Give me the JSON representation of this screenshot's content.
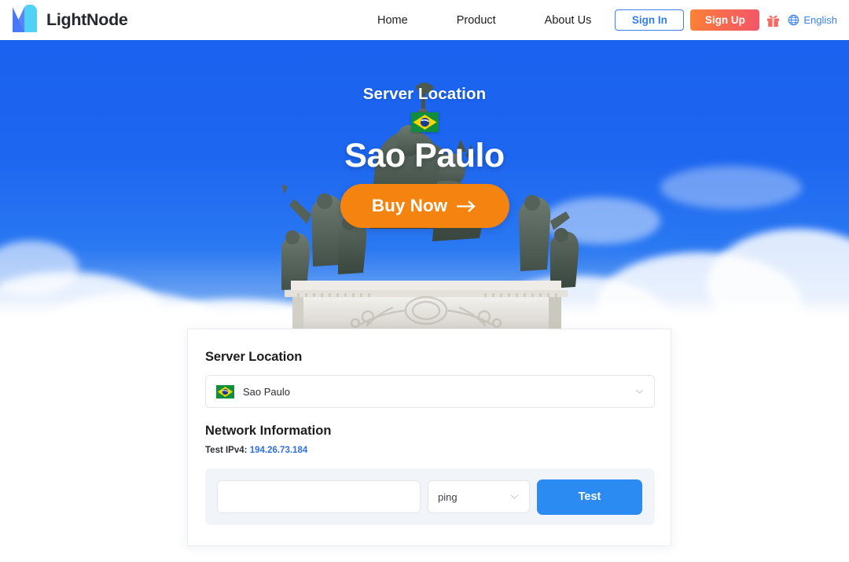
{
  "header": {
    "brand_name": "LightNode",
    "brand_logo_icon": "lightnode-logo-icon",
    "nav": [
      {
        "label": "Home"
      },
      {
        "label": "Product"
      },
      {
        "label": "About Us"
      }
    ],
    "sign_in_label": "Sign In",
    "sign_up_label": "Sign Up",
    "gift_icon": "gift-icon",
    "globe_icon": "globe-icon",
    "language_label": "English"
  },
  "hero": {
    "title": "Server Location",
    "flag_icon": "brazil-flag-icon",
    "city": "Sao Paulo",
    "buy_label": "Buy Now",
    "arrow_icon": "arrow-right-icon"
  },
  "card": {
    "server_location_heading": "Server Location",
    "location_select": {
      "flag_icon": "brazil-flag-icon",
      "value": "Sao Paulo",
      "chevron_icon": "chevron-down-icon"
    },
    "network_heading": "Network Information",
    "ip_label": "Test IPv4:",
    "ip_value": "194.26.73.184",
    "tool": {
      "input_value": "",
      "input_placeholder": "",
      "method_value": "ping",
      "method_chevron_icon": "chevron-down-icon",
      "test_label": "Test"
    }
  },
  "colors": {
    "sky_blue": "#1a62ef",
    "accent_orange": "#f5830f",
    "primary_blue": "#2b8bf2",
    "link_blue": "#2f6fe0",
    "signup_gradient_start": "#fb8334",
    "signup_gradient_end": "#f4566a",
    "panel_gray": "#f1f4f9"
  }
}
